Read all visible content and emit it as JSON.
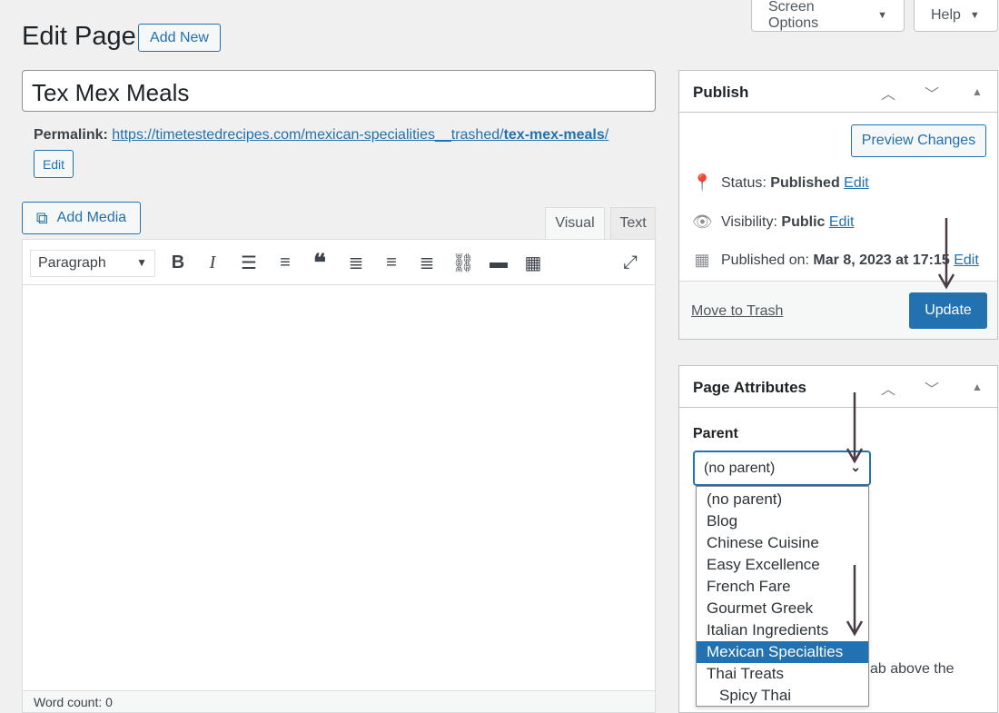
{
  "top_buttons": {
    "screen_options": "Screen Options",
    "help": "Help"
  },
  "page": {
    "title": "Edit Page",
    "add_new": "Add New"
  },
  "post": {
    "title": "Tex Mex Meals",
    "permalink_label": "Permalink:",
    "permalink_base": "https://timetestedrecipes.com/mexican-specialities__trashed/",
    "permalink_slug": "tex-mex-meals",
    "permalink_end": "/",
    "edit_label": "Edit"
  },
  "editor": {
    "add_media": "Add Media",
    "tab_visual": "Visual",
    "tab_text": "Text",
    "format_select": "Paragraph",
    "word_count": "Word count: 0"
  },
  "publish": {
    "title": "Publish",
    "preview": "Preview Changes",
    "status_label": "Status:",
    "status_value": "Published",
    "visibility_label": "Visibility:",
    "visibility_value": "Public",
    "published_label": "Published on:",
    "published_value": "Mar 8, 2023 at 17:15",
    "edit": "Edit",
    "trash": "Move to Trash",
    "update": "Update"
  },
  "attributes": {
    "title": "Page Attributes",
    "parent_label": "Parent",
    "parent_value": "(no parent)",
    "partial_text": "ab above the",
    "options": [
      "(no parent)",
      "Blog",
      "Chinese Cuisine",
      "Easy Excellence",
      "French Fare",
      "Gourmet Greek",
      "Italian Ingredients",
      "Mexican Specialties",
      "Thai Treats",
      "Spicy Thai"
    ],
    "selected_index": 7
  },
  "colors": {
    "accent": "#2271b1",
    "annotation_arrow": "#4a3c46"
  }
}
